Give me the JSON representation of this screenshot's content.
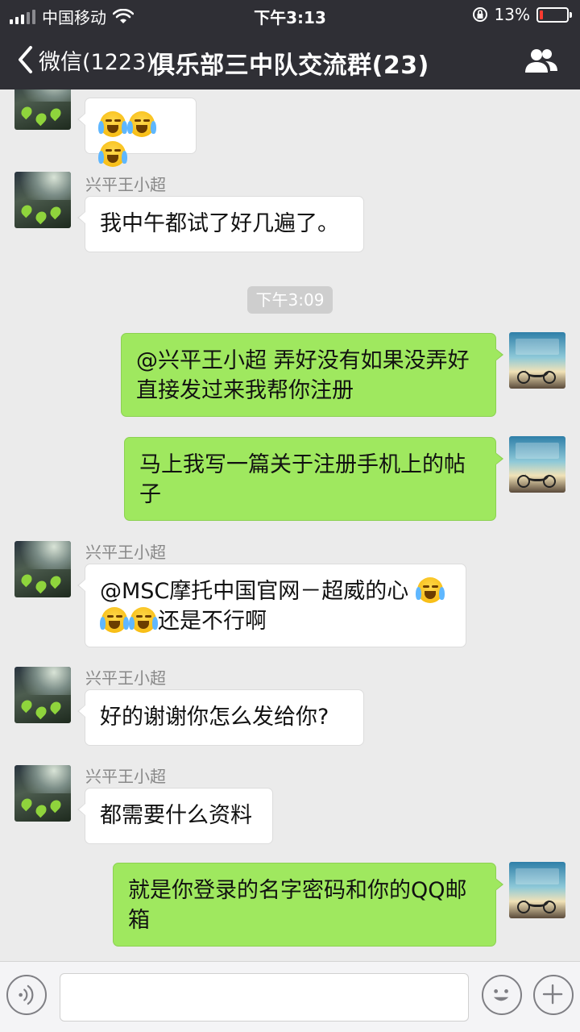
{
  "status_bar": {
    "carrier": "中国移动",
    "time": "下午3:13",
    "battery_percent": "13%",
    "battery_level": 0.13
  },
  "nav": {
    "back_label": "微信(1223)",
    "title": "俱乐部三中队交流群(23)"
  },
  "messages": [
    {
      "side": "in",
      "sender": "",
      "text": "",
      "emojis": 3
    },
    {
      "side": "in",
      "sender": "兴平王小超",
      "text": "我中午都试了好几遍了。"
    },
    {
      "side": "time",
      "text": "下午3:09"
    },
    {
      "side": "out",
      "line1": "@兴平王小超 弄好没有如果没弄好",
      "line2": "直接发过来我帮你注册"
    },
    {
      "side": "out",
      "line1": "马上我写一篇关于注册手机上的帖",
      "line2": "子"
    },
    {
      "side": "in",
      "sender": "兴平王小超",
      "line1": "@MSC摩托中国官网－超威的心",
      "line2": "还是不行啊"
    },
    {
      "side": "in",
      "sender": "兴平王小超",
      "text": "好的谢谢你怎么发给你?"
    },
    {
      "side": "in",
      "sender": "兴平王小超",
      "text": "都需要什么资料"
    },
    {
      "side": "out",
      "line1": "就是你登录的名字密码和你的QQ邮",
      "line2": "箱"
    }
  ],
  "colors": {
    "nav_bg": "#2f2f35",
    "chat_bg": "#ebebeb",
    "outgoing_bubble": "#9fe85f",
    "incoming_bubble": "#ffffff",
    "battery_low": "#ff3b30"
  },
  "icons": [
    "signal-icon",
    "wifi-icon",
    "lock-rotation-icon",
    "battery-icon",
    "back-chevron-icon",
    "group-members-icon",
    "voice-icon",
    "emoji-icon",
    "plus-icon",
    "crying-laughing-emoji"
  ]
}
